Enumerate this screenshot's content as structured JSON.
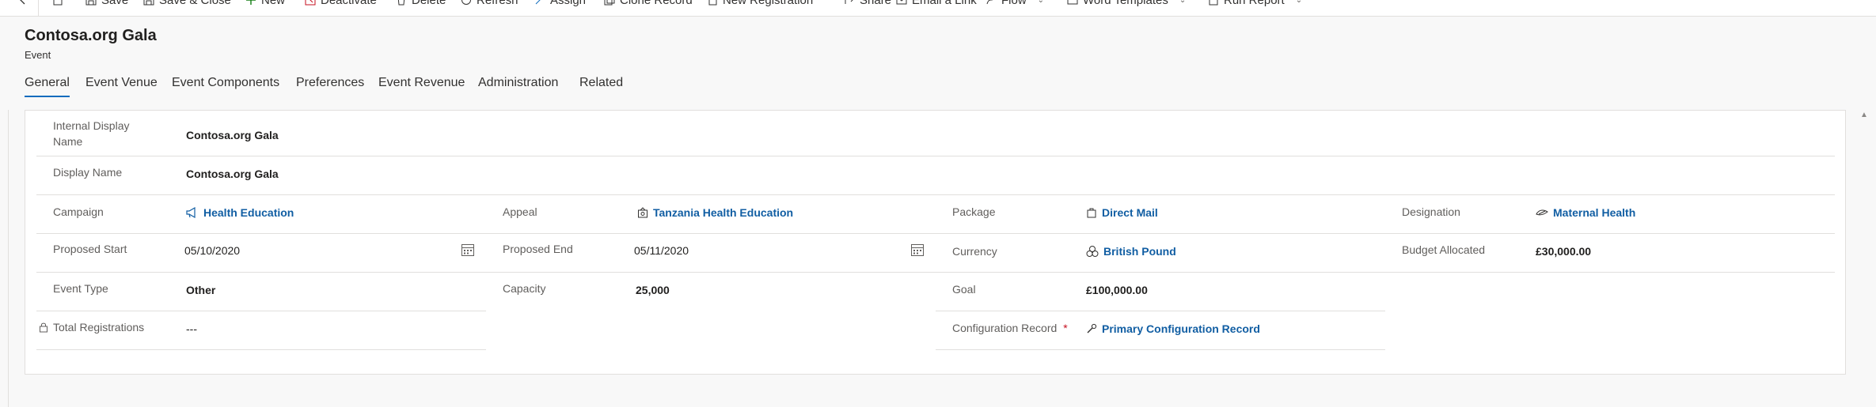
{
  "command_bar": {
    "items": [
      {
        "label": "",
        "icon": "back-icon"
      },
      {
        "label": "",
        "icon": "form-icon"
      },
      {
        "label": "Save",
        "icon": "save-icon"
      },
      {
        "label": "Save & Close",
        "icon": "save-close-icon"
      },
      {
        "label": "New",
        "icon": "plus-icon"
      },
      {
        "label": "Deactivate",
        "icon": "deactivate-icon"
      },
      {
        "label": "Delete",
        "icon": "delete-icon"
      },
      {
        "label": "Refresh",
        "icon": "refresh-icon"
      },
      {
        "label": "Assign",
        "icon": "assign-icon"
      },
      {
        "label": "Clone Record",
        "icon": "clone-icon"
      },
      {
        "label": "New Registration",
        "icon": "document-icon"
      },
      {
        "label": "Share",
        "icon": "share-icon"
      },
      {
        "label": "Email a Link",
        "icon": "email-icon"
      },
      {
        "label": "Flow",
        "icon": "flow-icon"
      },
      {
        "label": "Word Templates",
        "icon": "word-icon"
      },
      {
        "label": "Run Report",
        "icon": "report-icon"
      }
    ]
  },
  "header": {
    "title": "Contosa.org Gala",
    "entity": "Event"
  },
  "tabs": [
    {
      "label": "General",
      "active": true
    },
    {
      "label": "Event Venue"
    },
    {
      "label": "Event Components"
    },
    {
      "label": "Preferences"
    },
    {
      "label": "Event Revenue"
    },
    {
      "label": "Administration"
    },
    {
      "label": "Related"
    }
  ],
  "form": {
    "internal_display_name": {
      "label": "Internal Display Name",
      "value": "Contosa.org Gala"
    },
    "display_name": {
      "label": "Display Name",
      "value": "Contosa.org Gala"
    },
    "campaign": {
      "label": "Campaign",
      "value": "Health Education",
      "icon": "megaphone-icon"
    },
    "appeal": {
      "label": "Appeal",
      "value": "Tanzania Health Education",
      "icon": "appeal-icon"
    },
    "package": {
      "label": "Package",
      "value": "Direct Mail",
      "icon": "package-icon"
    },
    "designation": {
      "label": "Designation",
      "value": "Maternal Health",
      "icon": "designation-icon"
    },
    "proposed_start": {
      "label": "Proposed Start",
      "value": "05/10/2020"
    },
    "proposed_end": {
      "label": "Proposed End",
      "value": "05/11/2020"
    },
    "currency": {
      "label": "Currency",
      "value": "British Pound",
      "icon": "currency-icon"
    },
    "budget_allocated": {
      "label": "Budget Allocated",
      "value": "£30,000.00"
    },
    "event_type": {
      "label": "Event Type",
      "value": "Other"
    },
    "capacity": {
      "label": "Capacity",
      "value": "25,000"
    },
    "goal": {
      "label": "Goal",
      "value": "£100,000.00"
    },
    "total_registrations": {
      "label": "Total Registrations",
      "value": "---",
      "locked": true
    },
    "configuration_record": {
      "label": "Configuration Record",
      "required_marker": "*",
      "value": "Primary Configuration Record",
      "icon": "configuration-icon"
    }
  },
  "colors": {
    "accent": "#0f6cbd",
    "link": "#115ea3",
    "required": "#c50f1f"
  }
}
